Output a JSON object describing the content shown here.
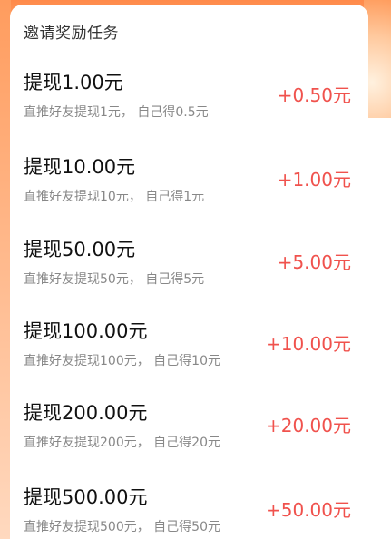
{
  "section": {
    "title": "邀请奖励任务"
  },
  "tasks": [
    {
      "title": "提现1.00元",
      "desc": "直推好友提现1元，  自己得0.5元",
      "reward": "+0.50元"
    },
    {
      "title": "提现10.00元",
      "desc": "直推好友提现10元，  自己得1元",
      "reward": "+1.00元"
    },
    {
      "title": "提现50.00元",
      "desc": "直推好友提现50元，  自己得5元",
      "reward": "+5.00元"
    },
    {
      "title": "提现100.00元",
      "desc": "直推好友提现100元，  自己得10元",
      "reward": "+10.00元"
    },
    {
      "title": "提现200.00元",
      "desc": "直推好友提现200元，  自己得20元",
      "reward": "+20.00元"
    },
    {
      "title": "提现500.00元",
      "desc": "直推好友提现500元，  自己得50元",
      "reward": "+50.00元"
    }
  ],
  "colors": {
    "reward": "#f0524d",
    "title": "#111111",
    "desc": "#888888",
    "header_bg": "#ff8a4a"
  }
}
